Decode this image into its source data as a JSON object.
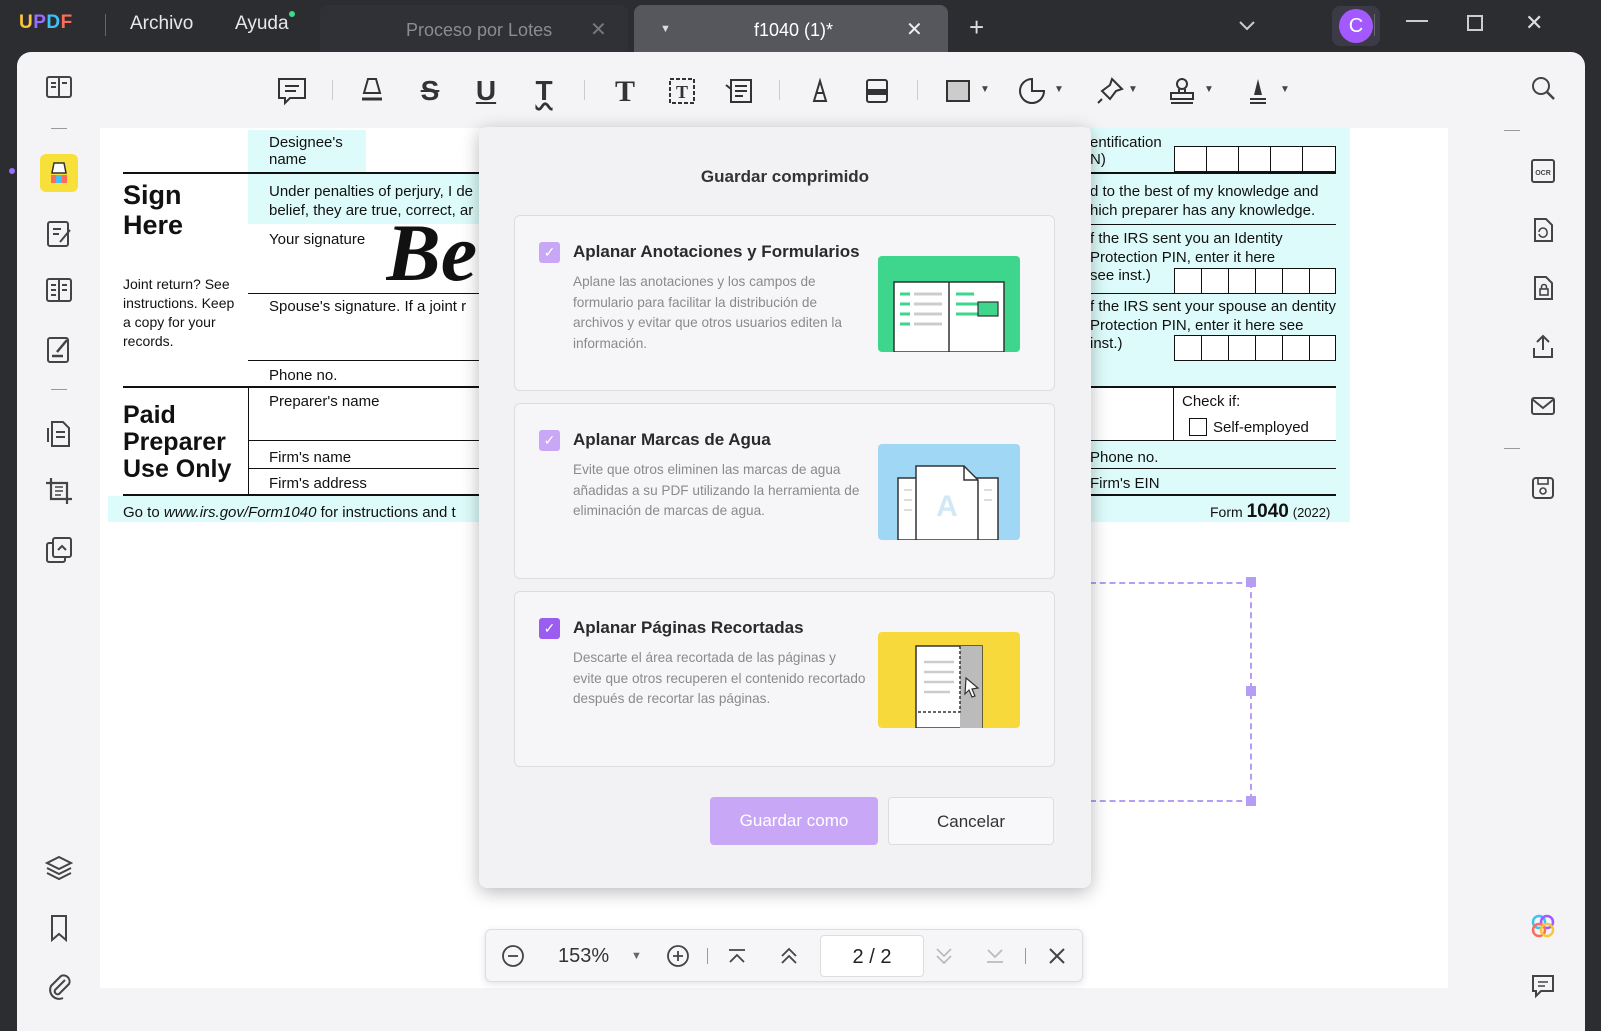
{
  "app": {
    "logo": "UPDF",
    "menu": {
      "archivo": "Archivo",
      "ayuda": "Ayuda"
    },
    "tabs": [
      {
        "label": "Proceso por Lotes",
        "active": false
      },
      {
        "label": "f1040 (1)*",
        "active": true
      }
    ],
    "avatar_initial": "C",
    "accent_color": "#a259ff"
  },
  "document": {
    "designee_label": "Designee's name",
    "identification_fragment": "entification N)",
    "sign_here": "Sign Here",
    "perjury_left": "Under penalties of perjury, I de belief, they are true, correct, ar",
    "perjury_right": "d to the best of my knowledge and hich preparer has any knowledge.",
    "your_signature": "Your signature",
    "signature_glyph": "Be",
    "irs_pin_you": "f the IRS sent you an Identity Protection PIN, enter it here see inst.)",
    "joint_return": "Joint return? See instructions. Keep a copy for your records.",
    "spouse_signature": "Spouse's signature. If a joint r",
    "irs_pin_spouse": "f the IRS sent your spouse an dentity Protection PIN, enter it here see inst.)",
    "phone_no": "Phone no.",
    "paid_preparer": "Paid Preparer Use Only",
    "preparers_name": "Preparer's name",
    "check_if": "Check if:",
    "self_employed": "Self-employed",
    "firms_name": "Firm's name",
    "phone_no_right": "Phone no.",
    "firms_address": "Firm's address",
    "firms_ein": "Firm's EIN",
    "footer_go": "Go to ",
    "footer_url": "www.irs.gov/Form1040",
    "footer_rest": " for instructions and t",
    "form_word": "Form",
    "form_number": "1040",
    "form_year": "(2022)"
  },
  "dialog": {
    "title": "Guardar comprimido",
    "options": [
      {
        "title": "Aplanar Anotaciones y Formularios",
        "description": "Aplane las anotaciones y los campos de formulario para facilitar la distribución de archivos y evitar que otros usuarios editen la información.",
        "checked": true,
        "illustration_bg": "#3dd68c"
      },
      {
        "title": "Aplanar Marcas de Agua",
        "description": "Evite que otros eliminen las marcas de agua añadidas a su PDF utilizando la herramienta de eliminación de marcas de agua.",
        "checked": true,
        "illustration_bg": "#9fd7f5"
      },
      {
        "title": "Aplanar Páginas Recortadas",
        "description": "Descarte el área recortada de las páginas y evite que otros recuperen el contenido recortado después de recortar las páginas.",
        "checked": true,
        "illustration_bg": "#f8d93b"
      }
    ],
    "save_as": "Guardar como",
    "cancel": "Cancelar"
  },
  "zoom": {
    "level": "153%",
    "current_page": "2",
    "separator": "/",
    "total_pages": "2"
  }
}
